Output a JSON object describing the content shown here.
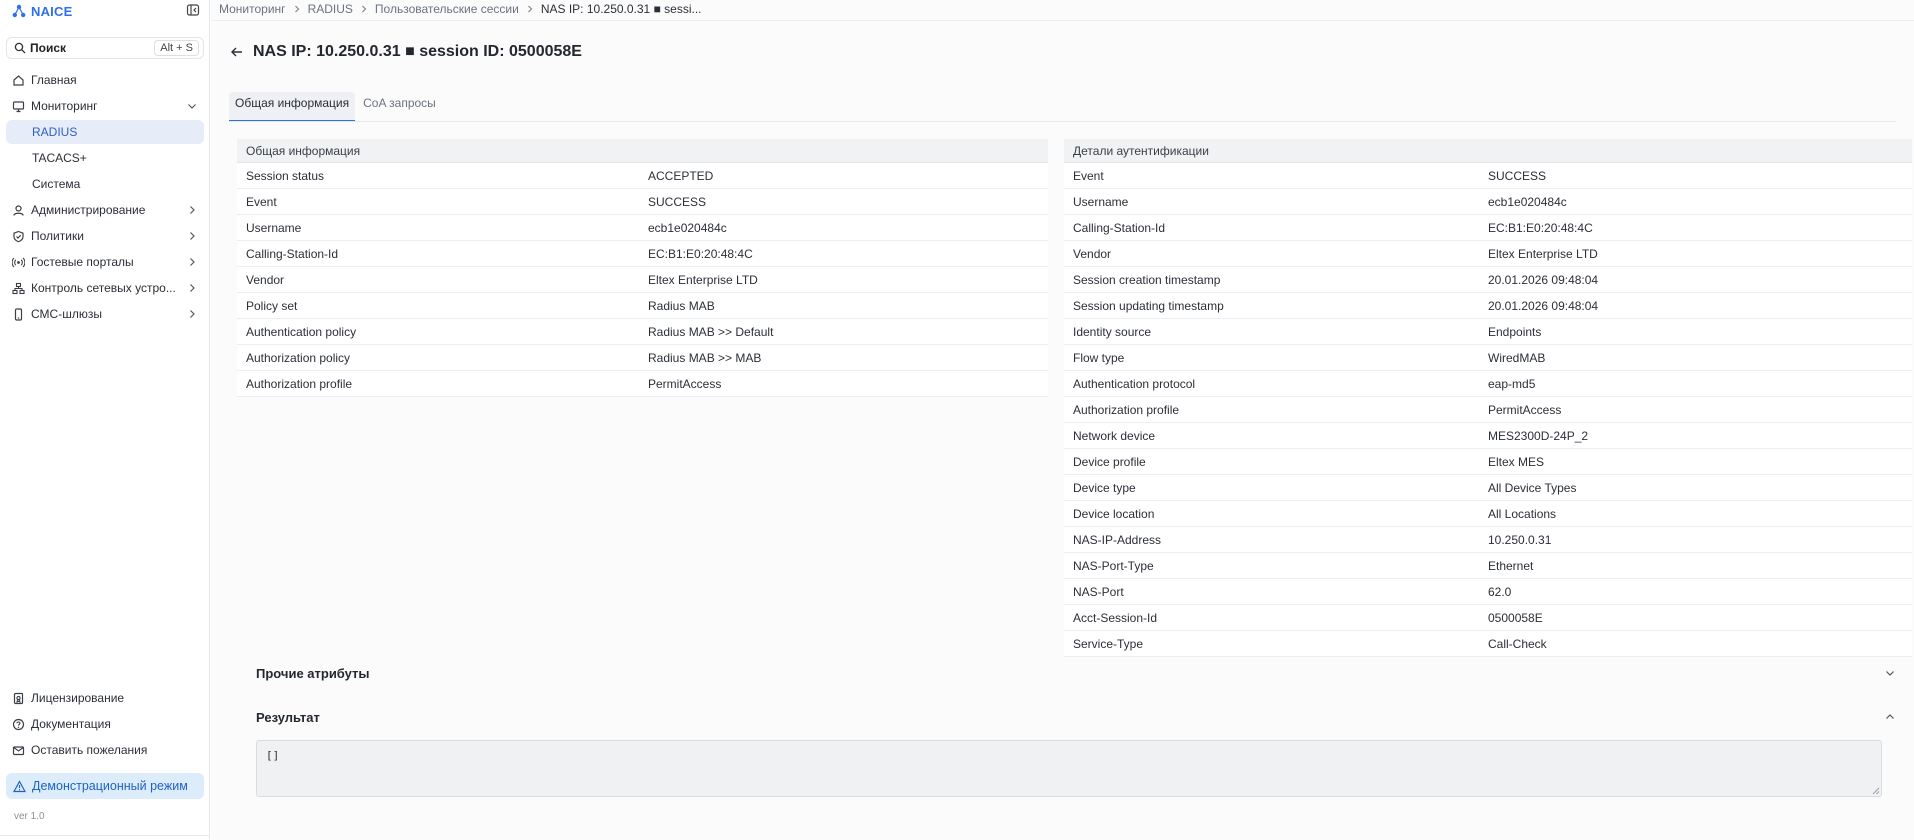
{
  "app": {
    "name": "NAICE"
  },
  "search": {
    "label": "Поиск",
    "shortcut": "Alt + S"
  },
  "nav": {
    "home": "Главная",
    "monitoring": "Мониторинг",
    "radius": "RADIUS",
    "tacacs": "TACACS+",
    "system": "Система",
    "administration": "Администрирование",
    "policies": "Политики",
    "guest_portals": "Гостевые порталы",
    "network_devices": "Контроль сетевых устро...",
    "sms_gateways": "СМС-шлюзы"
  },
  "nav_bottom": {
    "licensing": "Лицензирование",
    "docs": "Документация",
    "feedback": "Оставить пожелания",
    "demo": "Демонстрационный режим",
    "version": "ver 1.0"
  },
  "breadcrumb": {
    "c1": "Мониторинг",
    "c2": "RADIUS",
    "c3": "Пользовательские сессии",
    "c4": "NAS IP: 10.250.0.31 ■ sessi..."
  },
  "page": {
    "title": "NAS IP: 10.250.0.31 ■ session ID: 0500058E"
  },
  "tabs": {
    "general": "Общая информация",
    "coa": "CoA запросы"
  },
  "general_info": {
    "title": "Общая информация",
    "rows": [
      {
        "k": "Session status",
        "v": "ACCEPTED"
      },
      {
        "k": "Event",
        "v": "SUCCESS"
      },
      {
        "k": "Username",
        "v": "ecb1e020484c"
      },
      {
        "k": "Calling-Station-Id",
        "v": "EC:B1:E0:20:48:4C"
      },
      {
        "k": "Vendor",
        "v": "Eltex Enterprise LTD"
      },
      {
        "k": "Policy set",
        "v": "Radius MAB"
      },
      {
        "k": "Authentication policy",
        "v": "Radius MAB >> Default"
      },
      {
        "k": "Authorization policy",
        "v": "Radius MAB >> MAB"
      },
      {
        "k": "Authorization profile",
        "v": "PermitAccess"
      }
    ]
  },
  "auth_details": {
    "title": "Детали аутентификации",
    "rows": [
      {
        "k": "Event",
        "v": "SUCCESS"
      },
      {
        "k": "Username",
        "v": "ecb1e020484c"
      },
      {
        "k": "Calling-Station-Id",
        "v": "EC:B1:E0:20:48:4C"
      },
      {
        "k": "Vendor",
        "v": "Eltex Enterprise LTD"
      },
      {
        "k": "Session creation timestamp",
        "v": "20.01.2026 09:48:04"
      },
      {
        "k": "Session updating timestamp",
        "v": "20.01.2026 09:48:04"
      },
      {
        "k": "Identity source",
        "v": "Endpoints"
      },
      {
        "k": "Flow type",
        "v": "WiredMAB"
      },
      {
        "k": "Authentication protocol",
        "v": "eap-md5"
      },
      {
        "k": "Authorization profile",
        "v": "PermitAccess"
      },
      {
        "k": "Network device",
        "v": "MES2300D-24P_2"
      },
      {
        "k": "Device profile",
        "v": "Eltex MES"
      },
      {
        "k": "Device type",
        "v": "All Device Types"
      },
      {
        "k": "Device location",
        "v": "All Locations"
      },
      {
        "k": "NAS-IP-Address",
        "v": "10.250.0.31"
      },
      {
        "k": "NAS-Port-Type",
        "v": "Ethernet"
      },
      {
        "k": "NAS-Port",
        "v": "62.0"
      },
      {
        "k": "Acct-Session-Id",
        "v": "0500058E"
      },
      {
        "k": "Service-Type",
        "v": "Call-Check"
      }
    ]
  },
  "other_attrs": {
    "title": "Прочие атрибуты"
  },
  "result": {
    "title": "Результат",
    "value": "[]"
  },
  "colors": {
    "accent": "#2f6fed",
    "active_nav_bg": "#e6ecf8",
    "demo_bg": "#dcecfa"
  }
}
